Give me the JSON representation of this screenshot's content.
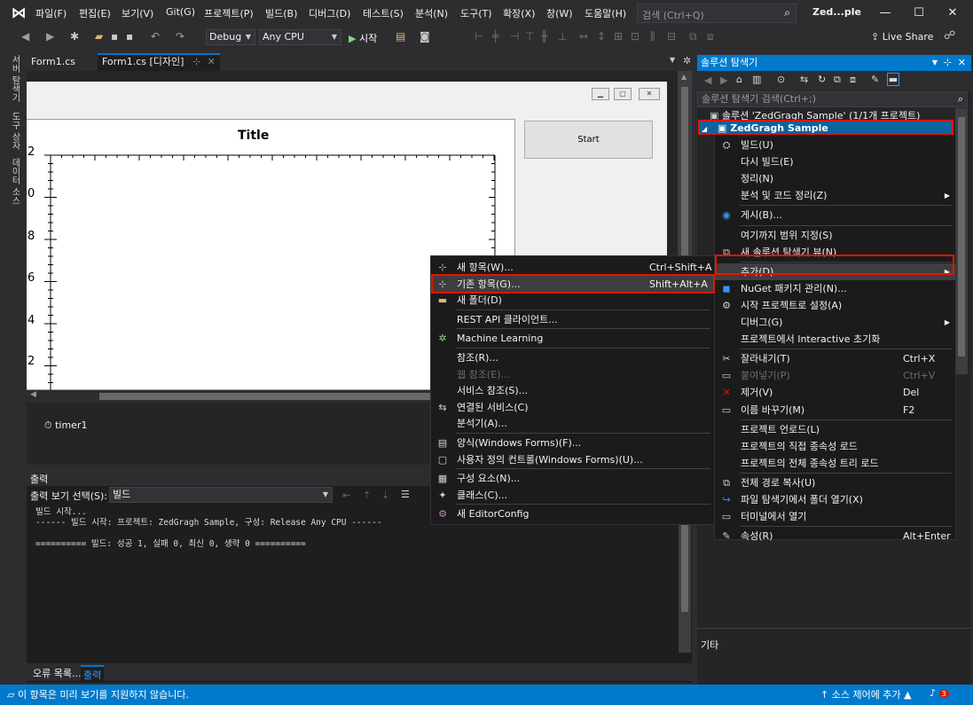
{
  "menubar": {
    "items": [
      "파일(F)",
      "편집(E)",
      "보기(V)",
      "Git(G)",
      "프로젝트(P)",
      "빌드(B)",
      "디버그(D)",
      "테스트(S)",
      "분석(N)",
      "도구(T)",
      "확장(X)",
      "창(W)",
      "도움말(H)"
    ],
    "search_placeholder": "검색 (Ctrl+Q)",
    "app_name": "Zed...ple"
  },
  "toolbar": {
    "config": "Debug",
    "platform": "Any CPU",
    "run_label": "시작",
    "live_share": "Live Share"
  },
  "left_strip": [
    "서버 탐색기",
    "도구 상자",
    "데이터 소스"
  ],
  "doc_tabs": [
    "Form1.cs",
    "Form1.cs [디자인]"
  ],
  "designer": {
    "graph_title": "Title",
    "y_ticks": [
      "2",
      "0",
      "8",
      "6",
      "4",
      "2"
    ],
    "start_button": "Start",
    "tray_component": "timer1"
  },
  "output": {
    "title": "출력",
    "source_label": "출력 보기 선택(S):",
    "source_value": "빌드",
    "lines": [
      "빌드 시작...",
      "------ 빌드 시작: 프로젝트: ZedGragh Sample, 구성: Release Any CPU ------",
      "",
      "========== 빌드: 성공 1, 실패 0, 최신 0, 생략 0 =========="
    ],
    "tabs": [
      "오류 목록...",
      "출력"
    ]
  },
  "solution_explorer": {
    "title": "솔루션 탐색기",
    "search_placeholder": "솔루션 탐색기 검색(Ctrl+;)",
    "solution_node": "솔루션 'ZedGragh Sample' (1/1개 프로젝트)",
    "project_node": "ZedGragh Sample",
    "properties_title": "기타"
  },
  "context_menu": {
    "items": [
      {
        "icon": "build-icon",
        "label": "빌드(U)",
        "shortcut": ""
      },
      {
        "icon": "",
        "label": "다시 빌드(E)",
        "shortcut": ""
      },
      {
        "icon": "",
        "label": "정리(N)",
        "shortcut": ""
      },
      {
        "icon": "",
        "label": "분석 및 코드 정리(Z)",
        "shortcut": ""
      },
      {
        "icon": "globe-icon",
        "label": "게시(B)...",
        "shortcut": ""
      },
      {
        "icon": "",
        "label": "여기까지 범위 지정(S)",
        "shortcut": ""
      },
      {
        "icon": "new-view-icon",
        "label": "새 솔루션 탐색기 뷰(N)",
        "shortcut": ""
      },
      {
        "icon": "",
        "label": "추가(D)",
        "shortcut": ""
      },
      {
        "icon": "nuget-icon",
        "label": "NuGet 패키지 관리(N)...",
        "shortcut": ""
      },
      {
        "icon": "gear-icon",
        "label": "시작 프로젝트로 설정(A)",
        "shortcut": ""
      },
      {
        "icon": "",
        "label": "디버그(G)",
        "shortcut": ""
      },
      {
        "icon": "",
        "label": "프로젝트에서 Interactive 초기화",
        "shortcut": ""
      },
      {
        "icon": "scissors-icon",
        "label": "잘라내기(T)",
        "shortcut": "Ctrl+X"
      },
      {
        "icon": "paste-icon",
        "label": "붙여넣기(P)",
        "shortcut": "Ctrl+V"
      },
      {
        "icon": "delete-icon",
        "label": "제거(V)",
        "shortcut": "Del"
      },
      {
        "icon": "rename-icon",
        "label": "이름 바꾸기(M)",
        "shortcut": "F2"
      },
      {
        "icon": "",
        "label": "프로젝트 언로드(L)",
        "shortcut": ""
      },
      {
        "icon": "",
        "label": "프로젝트의 직접 종속성 로드",
        "shortcut": ""
      },
      {
        "icon": "",
        "label": "프로젝트의 전체 종속성 트리 로드",
        "shortcut": ""
      },
      {
        "icon": "copy-icon",
        "label": "전체 경로 복사(U)",
        "shortcut": ""
      },
      {
        "icon": "folder-open-icon",
        "label": "파일 탐색기에서 폴더 열기(X)",
        "shortcut": ""
      },
      {
        "icon": "terminal-icon",
        "label": "터미널에서 열기",
        "shortcut": ""
      },
      {
        "icon": "wrench-icon",
        "label": "속성(R)",
        "shortcut": "Alt+Enter"
      }
    ]
  },
  "add_submenu": {
    "items": [
      {
        "icon": "new-item-icon",
        "label": "새 항목(W)...",
        "shortcut": "Ctrl+Shift+A"
      },
      {
        "icon": "existing-item-icon",
        "label": "기존 항목(G)...",
        "shortcut": "Shift+Alt+A"
      },
      {
        "icon": "folder-icon",
        "label": "새 폴더(D)",
        "shortcut": ""
      },
      {
        "icon": "",
        "label": "REST API 클라이언트...",
        "shortcut": ""
      },
      {
        "icon": "ml-icon",
        "label": "Machine Learning",
        "shortcut": ""
      },
      {
        "icon": "",
        "label": "참조(R)...",
        "shortcut": ""
      },
      {
        "icon": "",
        "label": "웹 참조(E)...",
        "shortcut": ""
      },
      {
        "icon": "",
        "label": "서비스 참조(S)...",
        "shortcut": ""
      },
      {
        "icon": "connected-service-icon",
        "label": "연결된 서비스(C)",
        "shortcut": ""
      },
      {
        "icon": "",
        "label": "분석기(A)...",
        "shortcut": ""
      },
      {
        "icon": "form-icon",
        "label": "양식(Windows Forms)(F)...",
        "shortcut": ""
      },
      {
        "icon": "user-control-icon",
        "label": "사용자 정의 컨트롤(Windows Forms)(U)...",
        "shortcut": ""
      },
      {
        "icon": "component-icon",
        "label": "구성 요소(N)...",
        "shortcut": ""
      },
      {
        "icon": "class-icon",
        "label": "클래스(C)...",
        "shortcut": ""
      },
      {
        "icon": "editorconfig-icon",
        "label": "새 EditorConfig",
        "shortcut": ""
      }
    ]
  },
  "statusbar": {
    "message": "이 항목은 미리 보기를 지원하지 않습니다.",
    "source_control": "소스 제어에 추가",
    "notification_count": "3"
  }
}
